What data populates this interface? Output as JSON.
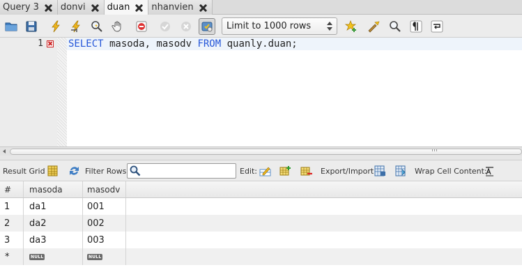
{
  "tabs": [
    {
      "label": "Query 3",
      "active": false
    },
    {
      "label": "donvi",
      "active": false
    },
    {
      "label": "duan",
      "active": true
    },
    {
      "label": "nhanvien",
      "active": false
    }
  ],
  "toolbar": {
    "limit_select_value": "Limit to 1000 rows",
    "icons": [
      "open-folder-icon",
      "save-icon",
      "execute-icon",
      "execute-current-icon",
      "explain-icon",
      "stop-icon",
      "toggle-error-icon",
      "commit-icon",
      "rollback-icon",
      "autocommit-icon",
      "bookmark-icon",
      "beautify-icon",
      "find-icon",
      "invisible-chars-icon",
      "wrap-icon"
    ]
  },
  "editor": {
    "line_number": "1",
    "sql_kw1": "SELECT",
    "sql_part1": " masoda, masodv ",
    "sql_kw2": "FROM",
    "sql_part2": " quanly.duan;"
  },
  "result_bar": {
    "result_grid_label": "Result Grid",
    "filter_rows_label": "Filter Rows:",
    "filter_value": "",
    "edit_label": "Edit:",
    "export_label": "Export/Import:",
    "wrap_label": "Wrap Cell Content:"
  },
  "grid": {
    "columns": [
      "#",
      "masoda",
      "masodv"
    ],
    "rows": [
      [
        "1",
        "da1",
        "001"
      ],
      [
        "2",
        "da2",
        "002"
      ],
      [
        "3",
        "da3",
        "003"
      ]
    ],
    "new_row_marker": "*",
    "null_label": "NULL"
  },
  "colors": {
    "keyword": "#2456d8",
    "current_line": "#eef4fb",
    "error_marker": "#cc1f1f"
  }
}
